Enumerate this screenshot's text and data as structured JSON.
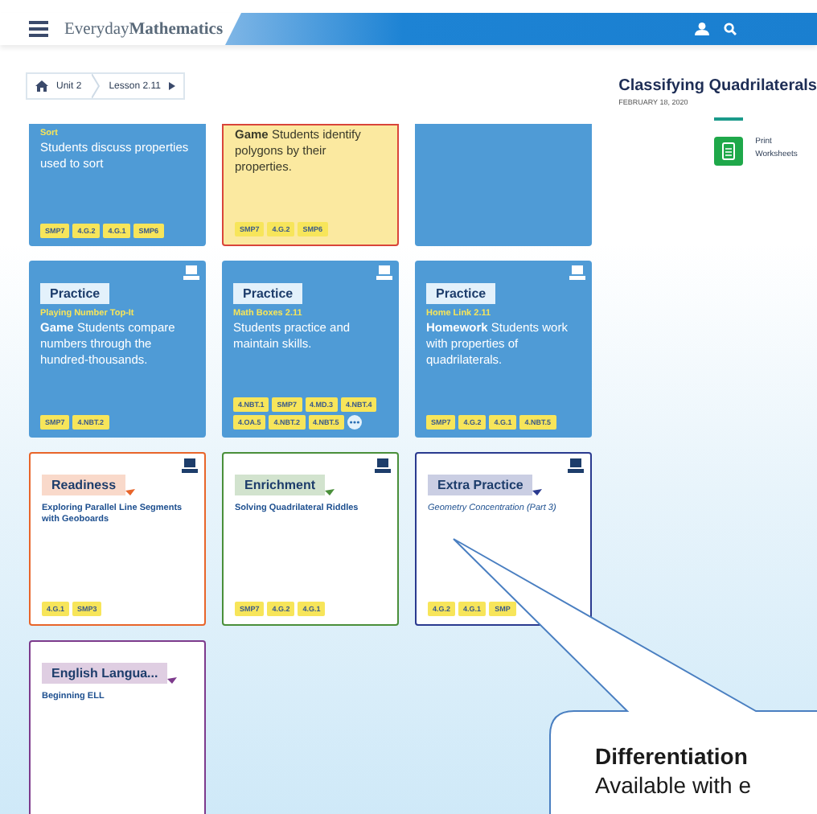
{
  "header": {
    "logo": "Everyday**Mathematics**"
  },
  "breadcrumb": [
    {
      "label": "Unit 2"
    },
    {
      "label": "Lesson 2.11"
    }
  ],
  "lesson": {
    "title": "Classifying Quadrilaterals",
    "date": "FEBRUARY 18, 2020"
  },
  "resources": [
    {
      "label": "Print Worksheets"
    }
  ],
  "cards": [
    {
      "kind": "activity",
      "highlighted": false,
      "digital": false,
      "more_button": false,
      "subtitle": "Sort",
      "description": "Students discuss properties used to sort",
      "tags": [
        "SMP7",
        "4.G.2",
        "4.G.1",
        "SMP6"
      ]
    },
    {
      "kind": "activity",
      "highlighted": true,
      "digital": false,
      "more_button": false,
      "description": "**Game** Students identify polygons by their properties.",
      "tags": [
        "SMP7",
        "4.G.2",
        "SMP6"
      ]
    },
    {
      "kind": "activity",
      "highlighted": false,
      "digital": false,
      "more_button": false
    },
    {
      "kind": "activity",
      "highlighted": false,
      "digital": true,
      "more_button": false,
      "heading": "Practice",
      "subtitle": "Playing Number Top-It",
      "description": "**Game** Students compare numbers through the hundred-thousands.",
      "tags": [
        "SMP7",
        "4.NBT.2"
      ]
    },
    {
      "kind": "activity",
      "highlighted": false,
      "digital": true,
      "more_button": true,
      "heading": "Practice",
      "subtitle": "Math Boxes 2.11",
      "description": "Students practice and maintain skills.",
      "tags": [
        "4.NBT.1",
        "SMP7",
        "4.MD.3",
        "4.NBT.4",
        "4.OA.5",
        "4.NBT.2",
        "4.NBT.5"
      ]
    },
    {
      "kind": "activity",
      "highlighted": false,
      "digital": true,
      "more_button": false,
      "heading": "Practice",
      "subtitle": "Home Link 2.11",
      "description": "**Homework** Students work with properties of quadrilaterals.",
      "tags": [
        "SMP7",
        "4.G.2",
        "4.G.1",
        "4.NBT.5"
      ]
    },
    {
      "kind": "differentiation",
      "color": "#e8652a",
      "italic": false,
      "digital": true,
      "heading": "Readiness",
      "description": "Exploring Parallel Line Segments with Geoboards",
      "tags": [
        "4.G.1",
        "SMP3"
      ]
    },
    {
      "kind": "differentiation",
      "color": "#4a8f3a",
      "italic": false,
      "digital": true,
      "heading": "Enrichment",
      "description": "Solving Quadrilateral Riddles",
      "tags": [
        "SMP7",
        "4.G.2",
        "4.G.1"
      ]
    },
    {
      "kind": "differentiation",
      "color": "#2a3a8f",
      "italic": true,
      "digital": true,
      "heading": "Extra Practice",
      "description": "Geometry Concentration (Part 3)",
      "tags": [
        "4.G.2",
        "4.G.1",
        "SMP"
      ]
    },
    {
      "kind": "differentiation",
      "color": "#7d3a8c",
      "italic": false,
      "digital": false,
      "heading": "English Langua...",
      "description": "Beginning ELL"
    }
  ],
  "callout": {
    "title": "Differentiation",
    "text": "Available with e"
  }
}
